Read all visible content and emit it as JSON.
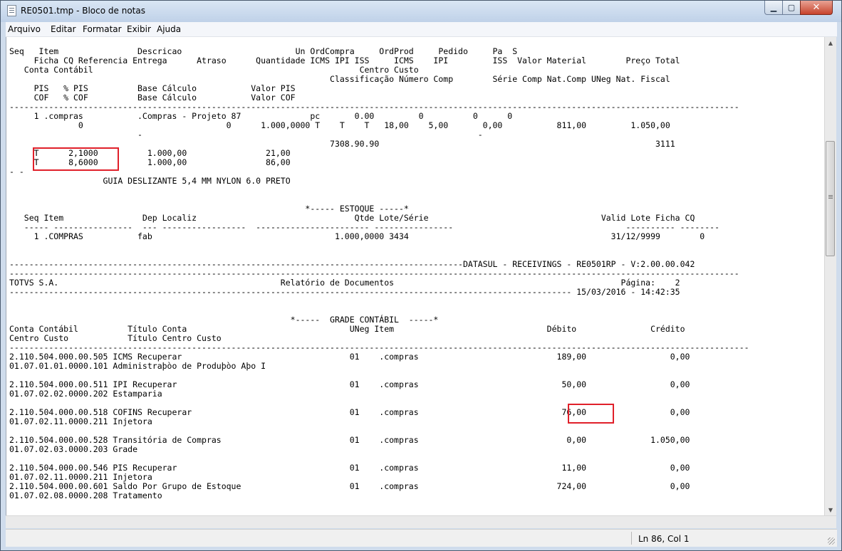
{
  "window": {
    "title": "RE0501.tmp - Bloco de notas",
    "controls": {
      "minimize": "▁",
      "maximize": "▢",
      "close": "✕"
    }
  },
  "menu": [
    "Arquivo",
    "Editar",
    "Formatar",
    "Exibir",
    "Ajuda"
  ],
  "lines": [
    "Seq   Item                Descricao                       Un OrdCompra     OrdProd     Pedido     Pa  S",
    "     Ficha CQ Referencia Entrega      Atraso      Quantidade ICMS IPI ISS     ICMS    IPI         ISS  Valor Material        Preço Total",
    "   Conta Contábil                                                      Centro Custo",
    "                                                                 Classificação Número Comp        Série Comp Nat.Comp UNeg Nat. Fiscal",
    "     PIS   % PIS          Base Cálculo           Valor PIS",
    "     COF   % COF          Base Cálculo           Valor COF",
    "----------------------------------------------------------------------------------------------------------------------------------------------------",
    "     1 .compras           .Compras - Projeto 87              pc       0.00         0          0      0",
    "              0                             0      1.000,0000 T    T    T   18,00    5,00       0,00           811,00         1.050,00",
    "                          -                                                                    -",
    "",
    "                                                                 7308.90.90                                                        3111",
    "     T      2,1000          1.000,00                21,00",
    "     T      8,6000          1.000,00                86,00",
    "- -",
    "                   GUIA DESLIZANTE 5,4 MM NYLON 6.0 PRETO",
    "",
    "",
    "                                                            *----- ESTOQUE -----*",
    "   Seq Item                Dep Localiz                                Qtde Lote/Série                                   Valid Lote Ficha CQ",
    "   ----- ----------------  --- -----------------  ----------------------- ----------------                                   ---------- --------",
    "     1 .COMPRAS           fab                                     1.000,0000 3434                                         31/12/9999        0",
    "",
    "",
    "--------------------------------------------------------------------------------------------DATASUL - RECEIVINGS - RE0501RP - V:2.00.00.042",
    "----------------------------------------------------------------------------------------------------------------------------------------------------",
    "TOTVS S.A.                                             Relatório de Documentos                                              Página:    2",
    "------------------------------------------------------------------------------------------------------------------ 15/03/2016 - 14:42:35",
    "",
    "",
    "                                                         *-----  GRADE CONTÁBIL  -----*",
    "Conta Contábil          Título Conta                                 UNeg Item                               Débito               Crédito",
    "Centro Custo            Título Centro Custo",
    "------------------------------------------------------------------------------------------------------------------------------------------------------",
    "2.110.504.000.00.505 ICMS Recuperar                                  01    .compras                            189,00                 0,00",
    "01.07.01.01.0000.101 Administraþòo de Produþòo Aþo I",
    "",
    "2.110.504.000.00.511 IPI Recuperar                                   01    .compras                             50,00                 0,00",
    "01.07.02.02.0000.202 Estamparia",
    "",
    "2.110.504.000.00.518 COFINS Recuperar                                01    .compras                             76,00                 0,00",
    "01.07.02.11.0000.211 Injetora",
    "",
    "2.110.504.000.00.528 Transitória de Compras                          01    .compras                              0,00             1.050,00",
    "01.07.02.03.0000.203 Grade",
    "",
    "2.110.504.000.00.546 PIS Recuperar                                   01    .compras                             11,00                 0,00",
    "01.07.02.11.0000.211 Injetora",
    "2.110.504.000.00.601 Saldo Por Grupo de Estoque                      01    .compras                            724,00                 0,00",
    "01.07.02.08.0000.208 Tratamento"
  ],
  "scrollbar": {
    "up": "▲",
    "down": "▼"
  },
  "status": {
    "position": "Ln 86, Col 1"
  }
}
